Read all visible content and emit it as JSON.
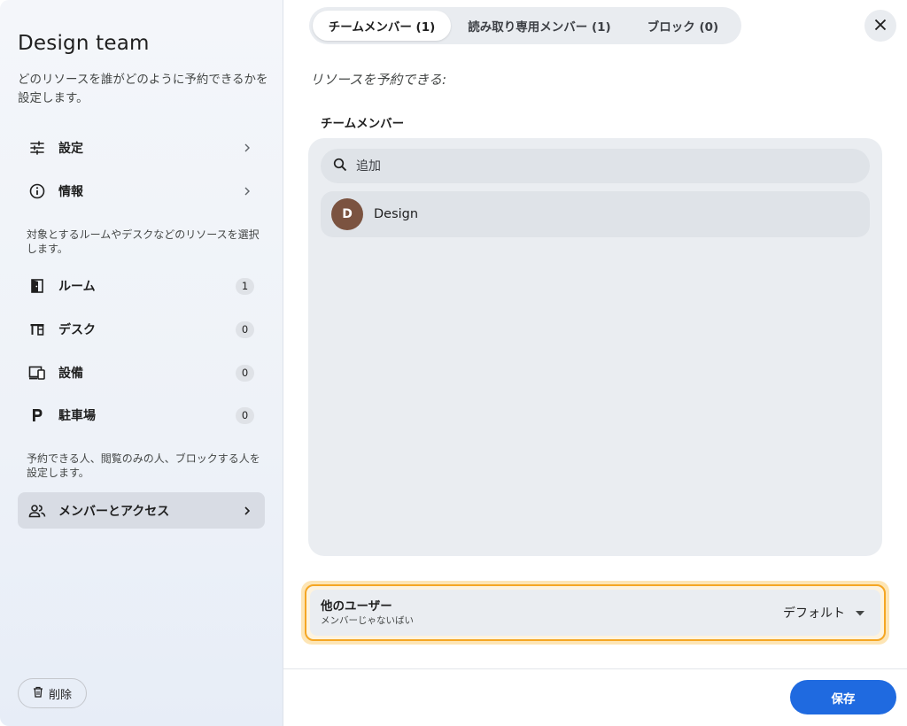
{
  "sidebar": {
    "title": "Design team",
    "description": "どのリソースを誰がどのように予約できるかを設定します。",
    "settings_label": "設定",
    "info_label": "情報",
    "resources_hint": "対象とするルームやデスクなどのリソースを選択します。",
    "resources": [
      {
        "label": "ルーム",
        "count": "1"
      },
      {
        "label": "デスク",
        "count": "0"
      },
      {
        "label": "設備",
        "count": "0"
      },
      {
        "label": "駐車場",
        "count": "0"
      }
    ],
    "access_hint": "予約できる人、閲覧のみの人、ブロックする人を設定します。",
    "members_access_label": "メンバーとアクセス",
    "delete_label": "削除"
  },
  "main": {
    "tabs": [
      {
        "label": "チームメンバー (1)",
        "active": true
      },
      {
        "label": "読み取り専用メンバー (1)",
        "active": false
      },
      {
        "label": "ブロック (0)",
        "active": false
      }
    ],
    "subtitle": "リソースを予約できる:",
    "section_title": "チームメンバー",
    "search_placeholder": "追加",
    "members": [
      {
        "initial": "D",
        "name": "Design",
        "avatar_color": "#7b5340"
      }
    ],
    "other_users": {
      "title": "他のユーザー",
      "subtitle": "メンバーじゃないばい",
      "role": "デフォルト"
    },
    "save_label": "保存"
  },
  "colors": {
    "accent": "#1f6ae0",
    "highlight_border": "#f5a623",
    "highlight_glow": "#fde5b5"
  }
}
